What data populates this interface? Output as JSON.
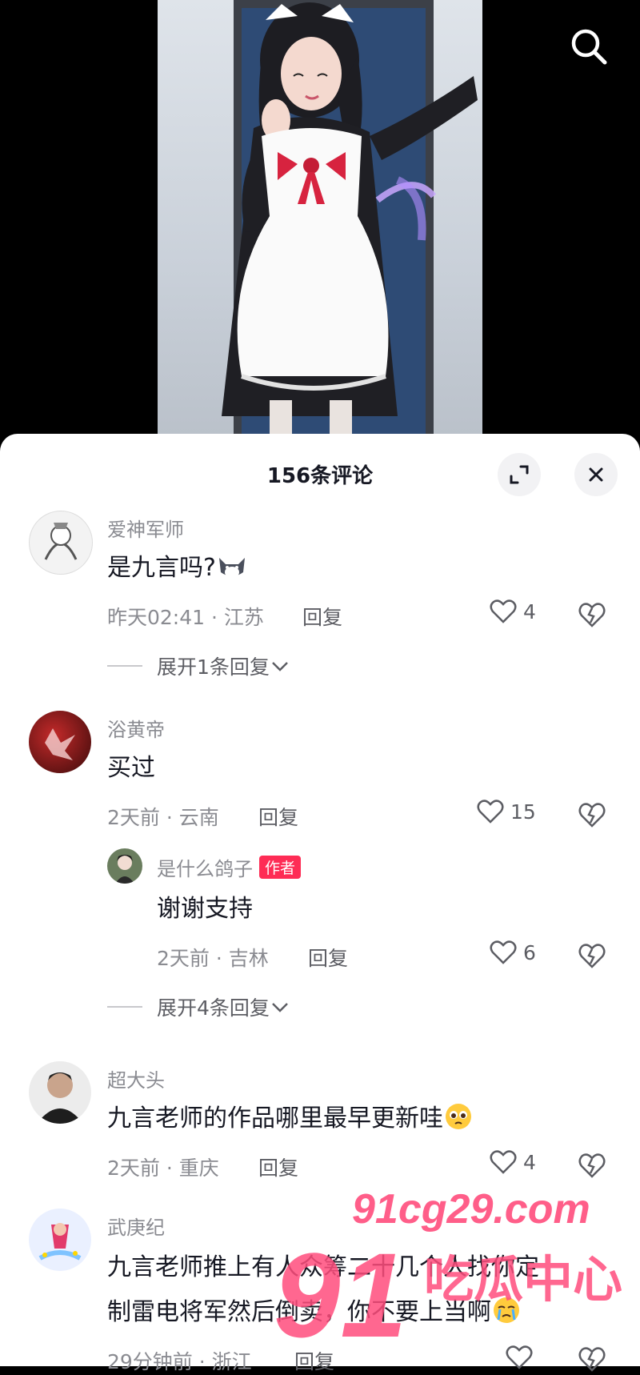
{
  "sheet": {
    "title": "156条评论"
  },
  "comments": [
    {
      "user": "爱神军师",
      "text": "是九言吗?",
      "time_loc": "昨天02:41 · 江苏",
      "reply": "回复",
      "likes": "4",
      "expand": "展开1条回复"
    },
    {
      "user": "浴黄帝",
      "text": "买过",
      "time_loc": "2天前 · 云南",
      "reply": "回复",
      "likes": "15",
      "sub": {
        "user": "是什么鸽子",
        "badge": "作者",
        "text": "谢谢支持",
        "time_loc": "2天前 · 吉林",
        "reply": "回复",
        "likes": "6"
      },
      "expand": "展开4条回复"
    },
    {
      "user": "超大头",
      "text": "九言老师的作品哪里最早更新哇",
      "time_loc": "2天前 · 重庆",
      "reply": "回复",
      "likes": "4"
    },
    {
      "user": "武庚纪",
      "text_line1": "九言老师推上有人众筹二十几个人找你定",
      "text_line2": "制雷电将军然后倒卖，你不要上当啊",
      "time_loc": "29分钟前 · 浙江",
      "reply": "回复"
    }
  ],
  "watermark": {
    "site": "91cg29.com",
    "number": "91",
    "name": "吃瓜中心"
  },
  "colors": {
    "accent": "#fe2c55",
    "watermark": "#ff4d7d"
  }
}
